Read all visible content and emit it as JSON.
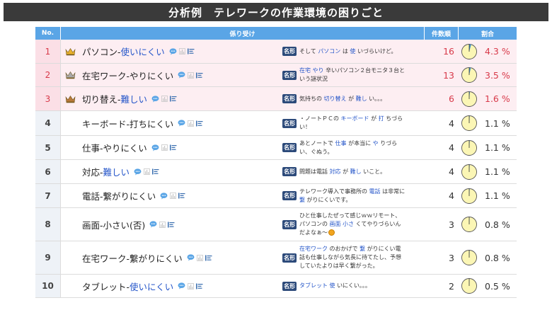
{
  "title": "分析例　テレワークの作業環境の困りごと",
  "header": {
    "no": "No.",
    "kakari": "係り受け",
    "count": "件数順",
    "ratio": "割合"
  },
  "tag_label": "名形",
  "colors": {
    "header_bg": "#5aa5e6",
    "title_bg": "#3a3a3a",
    "top_row_bg": "#fdeef2",
    "top_text": "#d83a4a",
    "keyword_blue": "#2455c9",
    "pie_fill": "#fbf6b5"
  },
  "rows": [
    {
      "no": "1",
      "top": true,
      "crown": "gold-crown-icon",
      "kw_a": "パソコン-",
      "kw_b": "使いにくい",
      "ex": [
        [
          "そして ",
          0
        ],
        [
          "パソコン",
          1
        ],
        [
          " は ",
          0
        ],
        [
          "使",
          1
        ],
        [
          " いづらいけど。",
          0
        ]
      ],
      "count": "16",
      "pct": "4.3 %",
      "ratio": 0.043
    },
    {
      "no": "2",
      "top": true,
      "crown": "silver-crown-icon",
      "kw_a": "在宅ワーク-やりにくい",
      "kw_b": "",
      "ex": [
        [
          "在宅",
          1
        ],
        [
          " ",
          0
        ],
        [
          "やり",
          1
        ],
        [
          " 辛いパソコン２台モニタ３台という謎状況",
          0
        ]
      ],
      "count": "13",
      "pct": "3.5 %",
      "ratio": 0.035
    },
    {
      "no": "3",
      "top": true,
      "crown": "bronze-crown-icon",
      "kw_a": "切り替え-",
      "kw_b": "難しい",
      "ex": [
        [
          "気持ちの ",
          0
        ],
        [
          "切り替え",
          1
        ],
        [
          " が ",
          0
        ],
        [
          "難し",
          1
        ],
        [
          " い。。。",
          0
        ]
      ],
      "count": "6",
      "pct": "1.6 %",
      "ratio": 0.016
    },
    {
      "no": "4",
      "top": false,
      "crown": "",
      "kw_a": "キーボード-打ちにくい",
      "kw_b": "",
      "ex": [
        [
          "・ノートＰＣの ",
          0
        ],
        [
          "キーボード",
          1
        ],
        [
          " が ",
          0
        ],
        [
          "打",
          1
        ],
        [
          " ちづらい！",
          0
        ]
      ],
      "count": "4",
      "pct": "1.1 %",
      "ratio": 0.011
    },
    {
      "no": "5",
      "top": false,
      "crown": "",
      "kw_a": "仕事-やりにくい",
      "kw_b": "",
      "ex": [
        [
          "あとノートで ",
          0
        ],
        [
          "仕事",
          1
        ],
        [
          " が本当に ",
          0
        ],
        [
          "や",
          1
        ],
        [
          " りづらい、ぐぬう。",
          0
        ]
      ],
      "count": "4",
      "pct": "1.1 %",
      "ratio": 0.011
    },
    {
      "no": "6",
      "top": false,
      "crown": "",
      "kw_a": "対応-",
      "kw_b": "難しい",
      "ex": [
        [
          "問題は電話 ",
          0
        ],
        [
          "対応",
          1
        ],
        [
          " が ",
          0
        ],
        [
          "難し",
          1
        ],
        [
          " いこと。",
          0
        ]
      ],
      "count": "4",
      "pct": "1.1 %",
      "ratio": 0.011
    },
    {
      "no": "7",
      "top": false,
      "crown": "",
      "kw_a": "電話-繋がりにくい",
      "kw_b": "",
      "ex": [
        [
          "テレワーク導入で事務所の ",
          0
        ],
        [
          "電話",
          1
        ],
        [
          " は非常に ",
          0
        ],
        [
          "繋",
          1
        ],
        [
          " がりにくいです。",
          0
        ]
      ],
      "count": "4",
      "pct": "1.1 %",
      "ratio": 0.011
    },
    {
      "no": "8",
      "top": false,
      "crown": "",
      "kw_a": "画面-小さい(否)",
      "kw_b": "",
      "ex": [
        [
          "ひと仕事したぜって感じｗｗリモート、パソコンの ",
          0
        ],
        [
          "画面",
          1
        ],
        [
          " ",
          0
        ],
        [
          "小さ",
          1
        ],
        [
          " くてやりづらいんだよなぁ～",
          0
        ]
      ],
      "emoji": true,
      "count": "3",
      "pct": "0.8 %",
      "ratio": 0.008
    },
    {
      "no": "9",
      "top": false,
      "crown": "",
      "kw_a": "在宅ワーク-繋がりにくい",
      "kw_b": "",
      "ex": [
        [
          "在宅ワーク",
          1
        ],
        [
          " のおかげで ",
          0
        ],
        [
          "繋",
          1
        ],
        [
          " がりにくい電話も仕事しながら気長に待てたし、予想していたよりは早く繋がった。",
          0
        ]
      ],
      "count": "3",
      "pct": "0.8 %",
      "ratio": 0.008
    },
    {
      "no": "10",
      "top": false,
      "crown": "",
      "kw_a": "タブレット-",
      "kw_b": "使いにくい",
      "ex": [
        [
          "タブレット",
          1
        ],
        [
          " ",
          0
        ],
        [
          "使",
          1
        ],
        [
          " いにくい。。。",
          0
        ]
      ],
      "count": "2",
      "pct": "0.5 %",
      "ratio": 0.005
    }
  ]
}
